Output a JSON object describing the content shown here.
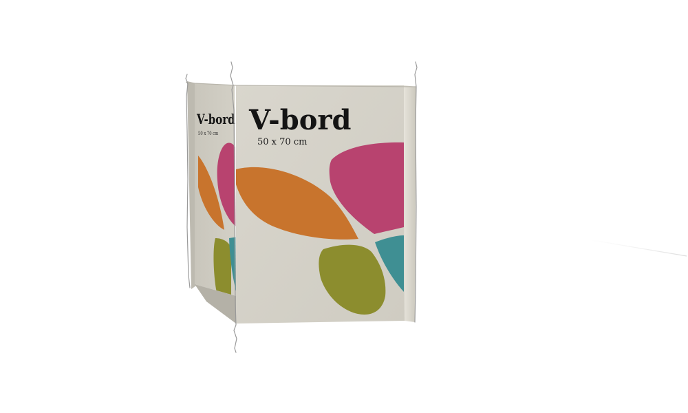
{
  "product": {
    "name": "V-bord",
    "size": "50 x 70 cm",
    "side_name": "V-bord",
    "side_size": "50 x 70 cm"
  },
  "colors": {
    "background": "#ffffff",
    "board": "#d8d5cc",
    "board_shadow": "#c3c0b6",
    "orange": "#c8742d",
    "magenta": "#b8436f",
    "teal": "#3f8f93",
    "olive": "#8c8d2e",
    "wire": "#9a9a9a"
  }
}
